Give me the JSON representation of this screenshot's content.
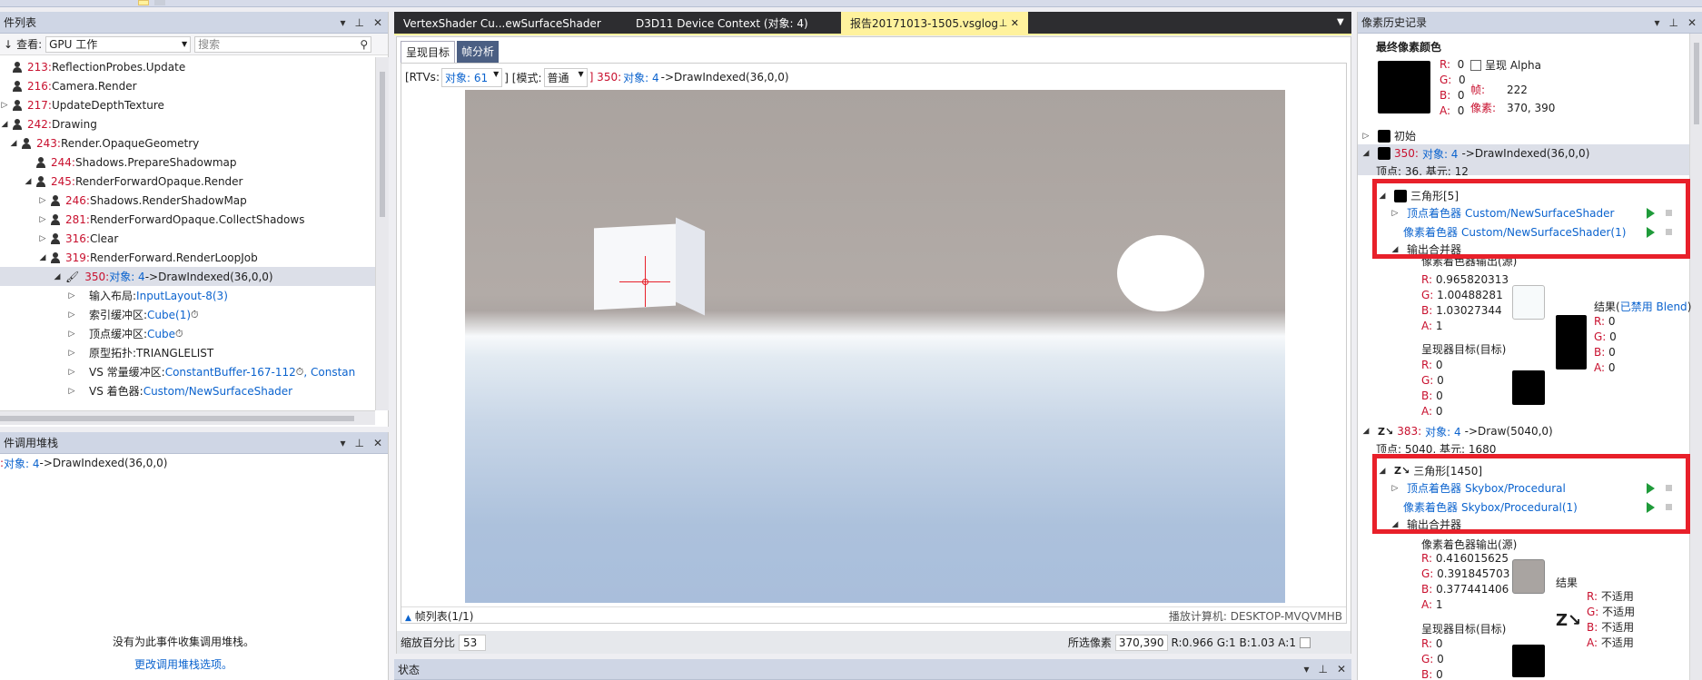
{
  "toolbar": {},
  "event_list": {
    "title": "件列表",
    "view_label": "查看:",
    "view_value": "GPU 工作",
    "search_placeholder": "搜索",
    "rows": [
      {
        "num": "213:",
        "text": " ReflectionProbes.Update",
        "indent": 0,
        "icon": "person",
        "exp": ""
      },
      {
        "num": "216:",
        "text": " Camera.Render",
        "indent": 0,
        "icon": "person",
        "exp": ""
      },
      {
        "num": "217:",
        "text": " UpdateDepthTexture",
        "indent": 0,
        "icon": "person",
        "exp": "▷"
      },
      {
        "num": "242:",
        "text": " Drawing",
        "indent": 0,
        "icon": "person",
        "exp": "◢"
      },
      {
        "num": "243:",
        "text": " Render.OpaqueGeometry",
        "indent": 1,
        "icon": "person",
        "exp": "◢"
      },
      {
        "num": "244:",
        "text": " Shadows.PrepareShadowmap",
        "indent": 2,
        "icon": "person",
        "exp": ""
      },
      {
        "num": "245:",
        "text": " RenderForwardOpaque.Render",
        "indent": 2,
        "icon": "person",
        "exp": "◢"
      },
      {
        "num": "246:",
        "text": " Shadows.RenderShadowMap",
        "indent": 3,
        "icon": "person",
        "exp": "▷"
      },
      {
        "num": "281:",
        "text": " RenderForwardOpaque.CollectShadows",
        "indent": 3,
        "icon": "person",
        "exp": "▷"
      },
      {
        "num": "316:",
        "text": " Clear",
        "indent": 3,
        "icon": "person",
        "exp": "▷"
      },
      {
        "num": "319:",
        "text": " RenderForward.RenderLoopJob",
        "indent": 3,
        "icon": "person",
        "exp": "◢"
      }
    ],
    "selected": {
      "num": "350:",
      "obj": " 对象: 4",
      "rest": "->DrawIndexed(36,0,0)"
    },
    "children": [
      {
        "label": "输入布局:",
        "link": "InputLayout-8(3)",
        "clock": false
      },
      {
        "label": "索引缓冲区:",
        "link": "Cube(1)",
        "clock": true
      },
      {
        "label": "顶点缓冲区:",
        "link": "Cube",
        "clock": true
      },
      {
        "label": "原型拓扑:TRIANGLELIST",
        "link": "",
        "clock": false
      },
      {
        "label": "VS 常量缓冲区:",
        "link": "ConstantBuffer-167-112",
        "clock": true,
        "extra": ", Constan"
      },
      {
        "label": "VS 着色器:",
        "link": "Custom/NewSurfaceShader",
        "clock": false
      }
    ]
  },
  "callstack": {
    "title": "件调用堆栈",
    "row_num": ":",
    "row_obj": " 对象: 4",
    "row_rest": "->DrawIndexed(36,0,0)",
    "empty_msg": "没有为此事件收集调用堆栈。",
    "link": "更改调用堆栈选项。"
  },
  "doc_tabs": [
    {
      "label": "VertexShader Cu...ewSurfaceShader",
      "active": false
    },
    {
      "label": "D3D11 Device Context (对象: 4)",
      "active": false
    },
    {
      "label": "报告20171013-1505.vsglog",
      "active": true
    }
  ],
  "viewer": {
    "subtabs": [
      "呈现目标",
      "帧分析"
    ],
    "rtv_prefix": "[RTVs:",
    "rtv_value": "对象: 61",
    "mode_prefix": "] [模式:",
    "mode_value": "普通",
    "call_num": "] 350:",
    "call_obj": " 对象: 4",
    "call_rest": "->DrawIndexed(36,0,0)",
    "frame_list": "帧列表(1/1)",
    "playback": "播放计算机: DESKTOP-MVQVMHB",
    "zoom_label": "缩放百分比",
    "zoom_value": "53",
    "selected_pixel_label": "所选像素",
    "selected_pixel_value": "370,390",
    "pixel_rgba": "R:0.966 G:1 B:1.03 A:1"
  },
  "status": {
    "title": "状态"
  },
  "history": {
    "title": "像素历史记录",
    "final_label": "最终像素颜色",
    "final": {
      "R": "0",
      "G": "0",
      "B": "0",
      "A": "0"
    },
    "alpha_label": "呈现 Alpha",
    "frame_label": "帧:",
    "frame_value": "222",
    "pixel_label": "像素:",
    "pixel_value": "370, 390",
    "initial": "初始",
    "draw1": {
      "num": "350:",
      "obj": " 对象: 4",
      "rest": "->DrawIndexed(36,0,0)",
      "sub": "顶点: 36, 基元: 12"
    },
    "tri1": "三角形[5]",
    "vs1_label": "顶点着色器",
    "vs1_val": "Custom/NewSurfaceShader",
    "ps1_label": "像素着色器",
    "ps1_val": "Custom/NewSurfaceShader(1)",
    "om1": "输出合并器",
    "ps_out1_label": "像素着色器输出(源)",
    "ps_out1": {
      "R": "0.965820313",
      "G": "1.00488281",
      "B": "1.03027344",
      "A": "1"
    },
    "result_label": "结果(",
    "blend_text": "已禁用 Blend",
    "result_close": ")",
    "result1": {
      "R": "0",
      "G": "0",
      "B": "0",
      "A": "0"
    },
    "rt1_label": "呈现器目标(目标)",
    "rt1": {
      "R": "0",
      "G": "0",
      "B": "0",
      "A": "0"
    },
    "draw2": {
      "num": "383:",
      "obj": " 对象: 4",
      "rest": "->Draw(5040,0)",
      "sub": "顶点: 5040, 基元: 1680"
    },
    "tri2": "三角形[1450]",
    "vs2_label": "顶点着色器",
    "vs2_val": "Skybox/Procedural",
    "ps2_label": "像素着色器",
    "ps2_val": "Skybox/Procedural(1)",
    "om2": "输出合并器",
    "ps_out2_label": "像素着色器输出(源)",
    "ps_out2": {
      "R": "0.416015625",
      "G": "0.391845703",
      "B": "0.377441406",
      "A": "1"
    },
    "result2_label": "结果",
    "result2": {
      "R": "不适用",
      "G": "不适用",
      "B": "不适用",
      "A": "不适用"
    },
    "rt2_label": "呈现器目标(目标)",
    "rt2": {
      "R": "0",
      "G": "0",
      "B": "0"
    }
  },
  "colors": {
    "accent": "#007acc",
    "tab_active": "#fff29d",
    "highlight": "#e8202a"
  }
}
